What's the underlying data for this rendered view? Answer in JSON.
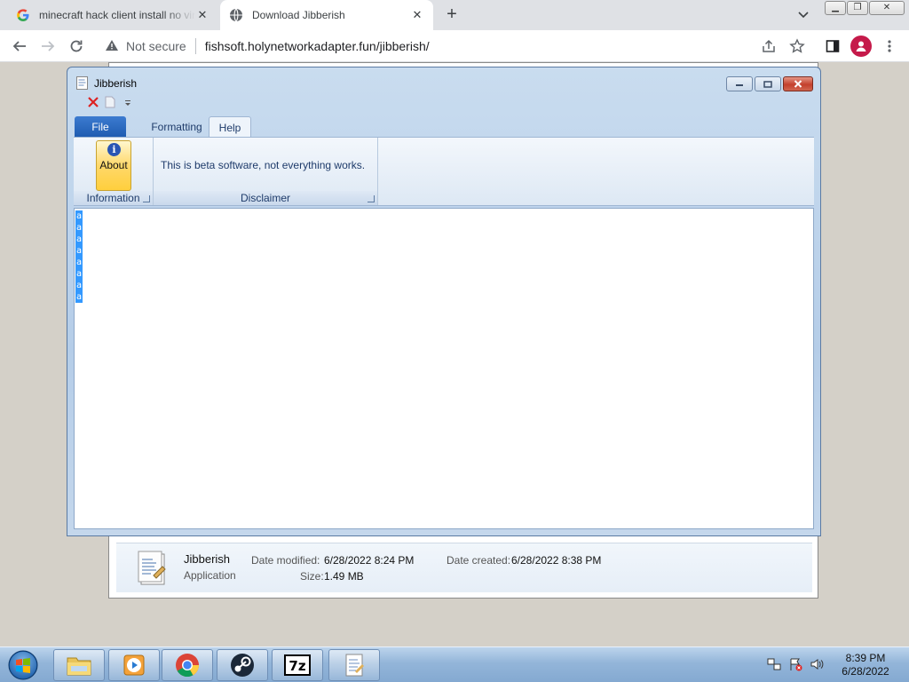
{
  "browser": {
    "tabs": [
      {
        "title": "minecraft hack client install no virus",
        "favicon": "google-g-icon"
      },
      {
        "title": "Download Jibberish",
        "favicon": "globe-icon"
      }
    ],
    "security_text": "Not secure",
    "url": "fishsoft.holynetworkadapter.fun/jibberish/"
  },
  "app": {
    "title": "Jibberish",
    "ribbon_tabs": [
      "File",
      "Formatting",
      "Help"
    ],
    "groups": {
      "information": {
        "label": "Information",
        "button": "About"
      },
      "disclaimer": {
        "label": "Disclaimer",
        "text": "This is beta software, not everything works."
      }
    },
    "editor_lines": [
      "a",
      "a",
      "a",
      "a",
      "a",
      "a",
      "a",
      "a"
    ]
  },
  "explorer_details": {
    "name": "Jibberish",
    "type": "Application",
    "date_modified_label": "Date modified:",
    "date_modified": "6/28/2022 8:24 PM",
    "date_created_label": "Date created:",
    "date_created": "6/28/2022 8:38 PM",
    "size_label": "Size:",
    "size": "1.49 MB"
  },
  "taskbar": {
    "time": "8:39 PM",
    "date": "6/28/2022",
    "pinned": [
      "explorer-icon",
      "media-player-icon",
      "chrome-icon",
      "steam-icon",
      "7zip-icon",
      "jibberish-icon"
    ]
  },
  "colors": {
    "selection": "#3399ff",
    "file_tab": "#1e5bb0",
    "avatar": "#c51a4a"
  }
}
